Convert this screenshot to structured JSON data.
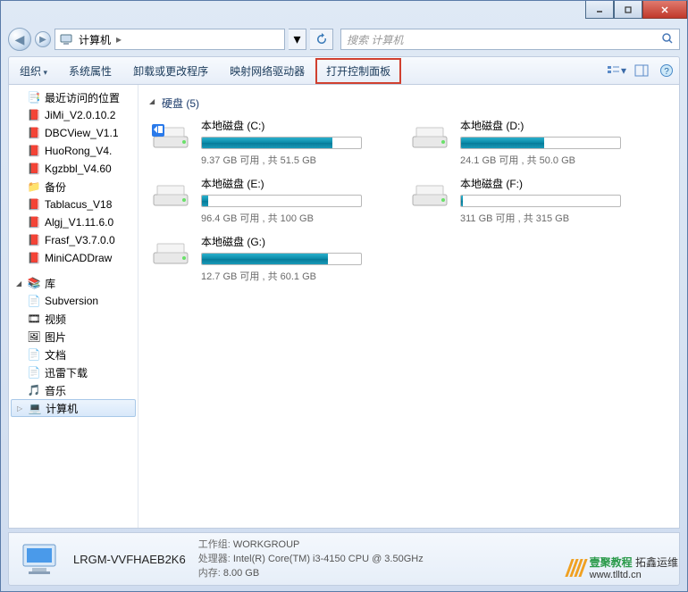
{
  "address": {
    "location": "计算机",
    "search_placeholder": "搜索 计算机"
  },
  "toolbar": {
    "organize": "组织",
    "properties": "系统属性",
    "uninstall": "卸载或更改程序",
    "map_drive": "映射网络驱动器",
    "control_panel": "打开控制面板"
  },
  "sidebar": {
    "recent": "最近访问的位置",
    "files": [
      "JiMi_V2.0.10.2",
      "DBCView_V1.1",
      "HuoRong_V4.",
      "Kgzbbl_V4.60"
    ],
    "backup": "备份",
    "files2": [
      "Tablacus_V18",
      "Algj_V1.11.6.0",
      "Frasf_V3.7.0.0",
      "MiniCADDraw"
    ],
    "libraries": "库",
    "lib_items": [
      "Subversion",
      "视频",
      "图片",
      "文档",
      "迅雷下载",
      "音乐"
    ],
    "computer": "计算机"
  },
  "section": {
    "title": "硬盘 (5)"
  },
  "drives": [
    {
      "name": "本地磁盘 (C:)",
      "stats": "9.37 GB 可用 , 共 51.5 GB",
      "pct": 82,
      "os": true
    },
    {
      "name": "本地磁盘 (D:)",
      "stats": "24.1 GB 可用 , 共 50.0 GB",
      "pct": 52
    },
    {
      "name": "本地磁盘 (E:)",
      "stats": "96.4 GB 可用 , 共 100 GB",
      "pct": 4
    },
    {
      "name": "本地磁盘 (F:)",
      "stats": "311 GB 可用 , 共 315 GB",
      "pct": 1
    },
    {
      "name": "本地磁盘 (G:)",
      "stats": "12.7 GB 可用 , 共 60.1 GB",
      "pct": 79
    }
  ],
  "details": {
    "name": "LRGM-VVFHAEB2K6",
    "workgroup_label": "工作组:",
    "workgroup": "WORKGROUP",
    "cpu_label": "处理器:",
    "cpu": "Intel(R) Core(TM) i3-4150 CPU @ 3.50GHz",
    "mem_label": "内存:",
    "mem": "8.00 GB"
  },
  "watermark": {
    "t1": "壹聚教程",
    "t2": "拓鑫运维",
    "url": "www.tlltd.cn"
  }
}
